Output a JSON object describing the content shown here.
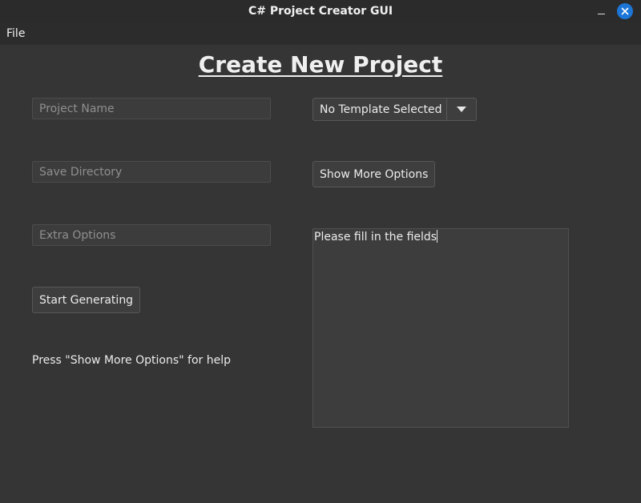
{
  "window": {
    "title": "C# Project Creator GUI"
  },
  "menu": {
    "items": [
      "File"
    ]
  },
  "main": {
    "title": "Create New Project",
    "project_name": {
      "placeholder": "Project Name",
      "value": ""
    },
    "save_directory": {
      "placeholder": "Save Directory",
      "value": ""
    },
    "extra_options": {
      "placeholder": "Extra Options",
      "value": ""
    },
    "start_button": "Start Generating",
    "help_text": "Press \"Show More Options\" for help",
    "template_select": {
      "selected": "No Template Selected"
    },
    "show_more_button": "Show More Options",
    "output_text": "Please fill in the fields"
  },
  "colors": {
    "background": "#353535",
    "titlebar": "#2b2b2b",
    "close_button": "#1c76d8"
  },
  "icons": {
    "close": "close-icon",
    "minimize": "minimize-icon",
    "dropdown": "chevron-down-icon"
  }
}
